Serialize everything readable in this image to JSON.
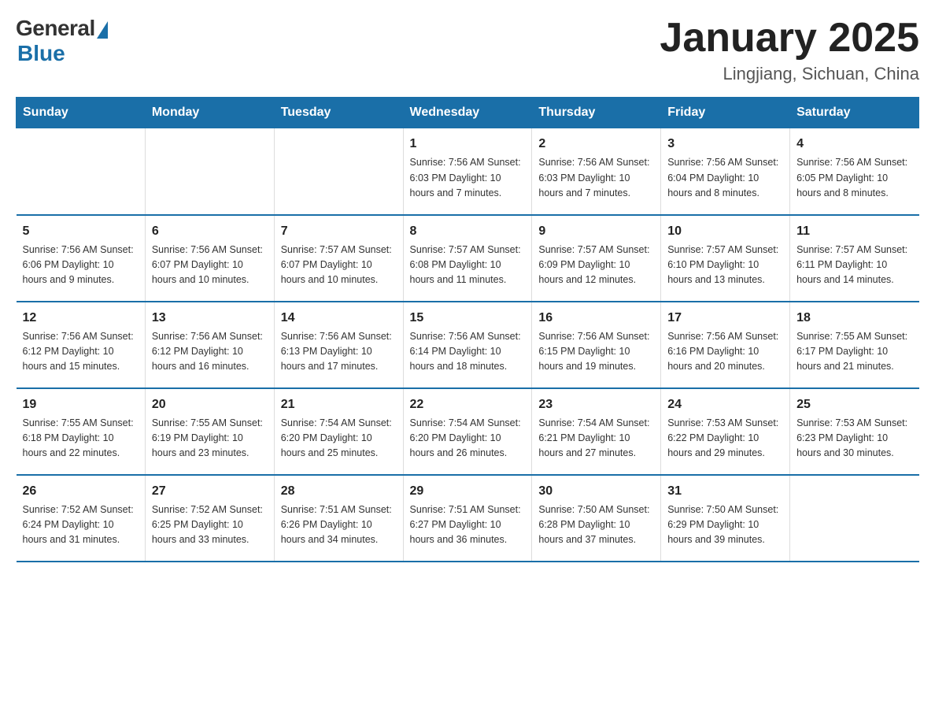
{
  "logo": {
    "general": "General",
    "blue": "Blue",
    "subtitle": "Blue"
  },
  "header": {
    "month": "January 2025",
    "location": "Lingjiang, Sichuan, China"
  },
  "weekdays": [
    "Sunday",
    "Monday",
    "Tuesday",
    "Wednesday",
    "Thursday",
    "Friday",
    "Saturday"
  ],
  "weeks": [
    [
      {
        "day": "",
        "info": ""
      },
      {
        "day": "",
        "info": ""
      },
      {
        "day": "",
        "info": ""
      },
      {
        "day": "1",
        "info": "Sunrise: 7:56 AM\nSunset: 6:03 PM\nDaylight: 10 hours\nand 7 minutes."
      },
      {
        "day": "2",
        "info": "Sunrise: 7:56 AM\nSunset: 6:03 PM\nDaylight: 10 hours\nand 7 minutes."
      },
      {
        "day": "3",
        "info": "Sunrise: 7:56 AM\nSunset: 6:04 PM\nDaylight: 10 hours\nand 8 minutes."
      },
      {
        "day": "4",
        "info": "Sunrise: 7:56 AM\nSunset: 6:05 PM\nDaylight: 10 hours\nand 8 minutes."
      }
    ],
    [
      {
        "day": "5",
        "info": "Sunrise: 7:56 AM\nSunset: 6:06 PM\nDaylight: 10 hours\nand 9 minutes."
      },
      {
        "day": "6",
        "info": "Sunrise: 7:56 AM\nSunset: 6:07 PM\nDaylight: 10 hours\nand 10 minutes."
      },
      {
        "day": "7",
        "info": "Sunrise: 7:57 AM\nSunset: 6:07 PM\nDaylight: 10 hours\nand 10 minutes."
      },
      {
        "day": "8",
        "info": "Sunrise: 7:57 AM\nSunset: 6:08 PM\nDaylight: 10 hours\nand 11 minutes."
      },
      {
        "day": "9",
        "info": "Sunrise: 7:57 AM\nSunset: 6:09 PM\nDaylight: 10 hours\nand 12 minutes."
      },
      {
        "day": "10",
        "info": "Sunrise: 7:57 AM\nSunset: 6:10 PM\nDaylight: 10 hours\nand 13 minutes."
      },
      {
        "day": "11",
        "info": "Sunrise: 7:57 AM\nSunset: 6:11 PM\nDaylight: 10 hours\nand 14 minutes."
      }
    ],
    [
      {
        "day": "12",
        "info": "Sunrise: 7:56 AM\nSunset: 6:12 PM\nDaylight: 10 hours\nand 15 minutes."
      },
      {
        "day": "13",
        "info": "Sunrise: 7:56 AM\nSunset: 6:12 PM\nDaylight: 10 hours\nand 16 minutes."
      },
      {
        "day": "14",
        "info": "Sunrise: 7:56 AM\nSunset: 6:13 PM\nDaylight: 10 hours\nand 17 minutes."
      },
      {
        "day": "15",
        "info": "Sunrise: 7:56 AM\nSunset: 6:14 PM\nDaylight: 10 hours\nand 18 minutes."
      },
      {
        "day": "16",
        "info": "Sunrise: 7:56 AM\nSunset: 6:15 PM\nDaylight: 10 hours\nand 19 minutes."
      },
      {
        "day": "17",
        "info": "Sunrise: 7:56 AM\nSunset: 6:16 PM\nDaylight: 10 hours\nand 20 minutes."
      },
      {
        "day": "18",
        "info": "Sunrise: 7:55 AM\nSunset: 6:17 PM\nDaylight: 10 hours\nand 21 minutes."
      }
    ],
    [
      {
        "day": "19",
        "info": "Sunrise: 7:55 AM\nSunset: 6:18 PM\nDaylight: 10 hours\nand 22 minutes."
      },
      {
        "day": "20",
        "info": "Sunrise: 7:55 AM\nSunset: 6:19 PM\nDaylight: 10 hours\nand 23 minutes."
      },
      {
        "day": "21",
        "info": "Sunrise: 7:54 AM\nSunset: 6:20 PM\nDaylight: 10 hours\nand 25 minutes."
      },
      {
        "day": "22",
        "info": "Sunrise: 7:54 AM\nSunset: 6:20 PM\nDaylight: 10 hours\nand 26 minutes."
      },
      {
        "day": "23",
        "info": "Sunrise: 7:54 AM\nSunset: 6:21 PM\nDaylight: 10 hours\nand 27 minutes."
      },
      {
        "day": "24",
        "info": "Sunrise: 7:53 AM\nSunset: 6:22 PM\nDaylight: 10 hours\nand 29 minutes."
      },
      {
        "day": "25",
        "info": "Sunrise: 7:53 AM\nSunset: 6:23 PM\nDaylight: 10 hours\nand 30 minutes."
      }
    ],
    [
      {
        "day": "26",
        "info": "Sunrise: 7:52 AM\nSunset: 6:24 PM\nDaylight: 10 hours\nand 31 minutes."
      },
      {
        "day": "27",
        "info": "Sunrise: 7:52 AM\nSunset: 6:25 PM\nDaylight: 10 hours\nand 33 minutes."
      },
      {
        "day": "28",
        "info": "Sunrise: 7:51 AM\nSunset: 6:26 PM\nDaylight: 10 hours\nand 34 minutes."
      },
      {
        "day": "29",
        "info": "Sunrise: 7:51 AM\nSunset: 6:27 PM\nDaylight: 10 hours\nand 36 minutes."
      },
      {
        "day": "30",
        "info": "Sunrise: 7:50 AM\nSunset: 6:28 PM\nDaylight: 10 hours\nand 37 minutes."
      },
      {
        "day": "31",
        "info": "Sunrise: 7:50 AM\nSunset: 6:29 PM\nDaylight: 10 hours\nand 39 minutes."
      },
      {
        "day": "",
        "info": ""
      }
    ]
  ]
}
